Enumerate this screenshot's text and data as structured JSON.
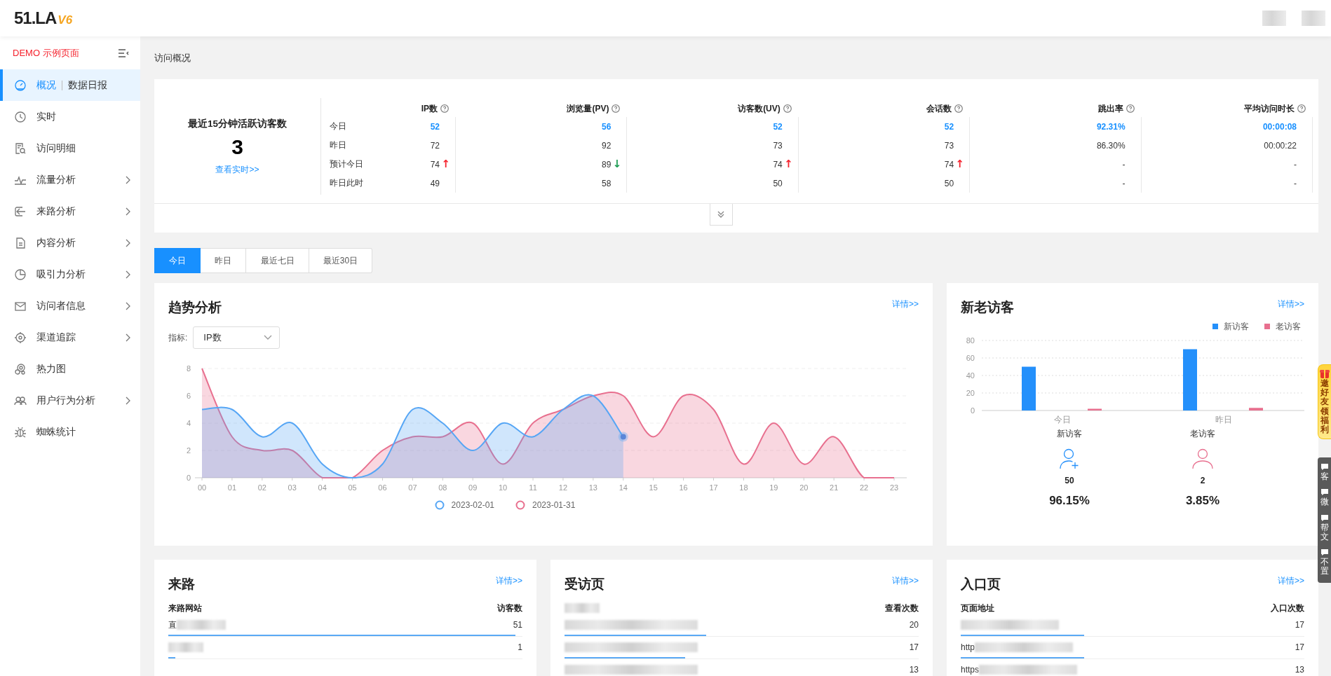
{
  "header": {
    "logo": "51.LA",
    "version": "V6"
  },
  "sidebar": {
    "demo_label": "DEMO 示例页面",
    "items": [
      {
        "label": "概况",
        "extra": "数据日报",
        "selected": true,
        "expandable": false
      },
      {
        "label": "实时",
        "selected": false,
        "expandable": false
      },
      {
        "label": "访问明细",
        "selected": false,
        "expandable": false
      },
      {
        "label": "流量分析",
        "selected": false,
        "expandable": true
      },
      {
        "label": "来路分析",
        "selected": false,
        "expandable": true
      },
      {
        "label": "内容分析",
        "selected": false,
        "expandable": true
      },
      {
        "label": "吸引力分析",
        "selected": false,
        "expandable": true
      },
      {
        "label": "访问者信息",
        "selected": false,
        "expandable": true
      },
      {
        "label": "渠道追踪",
        "selected": false,
        "expandable": true
      },
      {
        "label": "热力图",
        "selected": false,
        "expandable": false
      },
      {
        "label": "用户行为分析",
        "selected": false,
        "expandable": true
      },
      {
        "label": "蜘蛛统计",
        "selected": false,
        "expandable": false
      }
    ]
  },
  "breadcrumb": "访问概况",
  "overview": {
    "active_title": "最近15分钟活跃访客数",
    "active_count": "3",
    "realtime_link": "查看实时>>",
    "row_labels": [
      "今日",
      "昨日",
      "预计今日",
      "昨日此时"
    ],
    "columns": [
      {
        "title": "IP数",
        "values": [
          "52",
          "72",
          "74",
          "49"
        ],
        "arrow": "↑",
        "color": "#f5222d"
      },
      {
        "title": "浏览量(PV)",
        "values": [
          "56",
          "92",
          "89",
          "58"
        ],
        "arrow": "↓",
        "color": "#1f9d55"
      },
      {
        "title": "访客数(UV)",
        "values": [
          "52",
          "73",
          "74",
          "50"
        ],
        "arrow": "↑",
        "color": "#f5222d"
      },
      {
        "title": "会话数",
        "values": [
          "52",
          "73",
          "74",
          "50"
        ],
        "arrow": "↑",
        "color": "#f5222d"
      },
      {
        "title": "跳出率",
        "values": [
          "92.31%",
          "86.30%",
          "-",
          "-"
        ]
      },
      {
        "title": "平均访问时长",
        "values": [
          "00:00:08",
          "00:00:22",
          "-",
          "-"
        ]
      }
    ]
  },
  "range_tabs": [
    {
      "label": "今日",
      "selected": true
    },
    {
      "label": "昨日",
      "selected": false
    },
    {
      "label": "最近七日",
      "selected": false
    },
    {
      "label": "最近30日",
      "selected": false
    }
  ],
  "trend": {
    "title": "趋势分析",
    "detail_link": "详情>>",
    "metric_label": "指标:",
    "metric_value": "IP数",
    "chart_data": {
      "type": "area",
      "grid": true,
      "categories": [
        "00",
        "01",
        "02",
        "03",
        "04",
        "05",
        "06",
        "07",
        "08",
        "09",
        "10",
        "11",
        "12",
        "13",
        "14",
        "15",
        "16",
        "17",
        "18",
        "19",
        "20",
        "21",
        "22",
        "23"
      ],
      "ylim": [
        0,
        8
      ],
      "yticks": [
        0,
        2,
        4,
        6,
        8
      ],
      "series": [
        {
          "name": "2023-02-01",
          "color": "#56a6f5",
          "values": [
            5,
            5,
            3,
            4,
            1,
            0,
            1,
            5,
            4,
            2,
            4,
            3,
            5,
            6,
            3,
            null,
            null,
            null,
            null,
            null,
            null,
            null,
            null,
            null
          ]
        },
        {
          "name": "2023-01-31",
          "color": "#e8708f",
          "values": [
            8,
            3,
            2,
            2,
            0,
            0,
            2,
            3,
            3,
            4,
            1,
            4,
            5,
            6,
            6,
            3,
            6,
            5,
            1,
            4,
            1,
            3,
            0,
            0
          ]
        }
      ]
    }
  },
  "visitors": {
    "title": "新老访客",
    "detail_link": "详情>>",
    "chart_data": {
      "type": "bar",
      "grid": true,
      "categories": [
        "今日",
        "昨日"
      ],
      "ylim": [
        0,
        80
      ],
      "yticks": [
        0,
        20,
        40,
        60,
        80
      ],
      "series": [
        {
          "name": "新访客",
          "color": "#2490fb",
          "values": [
            50,
            70
          ]
        },
        {
          "name": "老访客",
          "color": "#e8708f",
          "values": [
            2,
            3
          ]
        }
      ]
    },
    "summary": [
      {
        "label": "新访客",
        "kind": "new",
        "color": "#2490fb",
        "count": "50",
        "percent": "96.15%"
      },
      {
        "label": "老访客",
        "kind": "returning",
        "color": "#e8708f",
        "count": "2",
        "percent": "3.85%"
      }
    ]
  },
  "lists": [
    {
      "title": "来路",
      "detail_link": "详情>>",
      "name_column": "来路网站",
      "value_column": "访客数",
      "rows": [
        {
          "text": "直",
          "value": "51",
          "level": 0.98
        },
        {
          "value": "1",
          "level": 0.02
        }
      ]
    },
    {
      "title": "受访页",
      "detail_link": "详情>>",
      "value_column": "查看次数",
      "rows": [
        {
          "value": "20",
          "level": 0.4
        },
        {
          "value": "17",
          "level": 0.34
        },
        {
          "value": "13"
        }
      ]
    },
    {
      "title": "入口页",
      "detail_link": "详情>>",
      "name_column": "页面地址",
      "value_column": "入口次数",
      "rows": [
        {
          "value": "17",
          "level": 0.36
        },
        {
          "text": "http",
          "value": "17",
          "level": 0.36
        },
        {
          "text": "https",
          "value": "13"
        }
      ]
    }
  ],
  "side_widgets": {
    "banner": "邀好友领福利",
    "tools": [
      "客",
      "微",
      "帮文",
      "不置"
    ]
  }
}
